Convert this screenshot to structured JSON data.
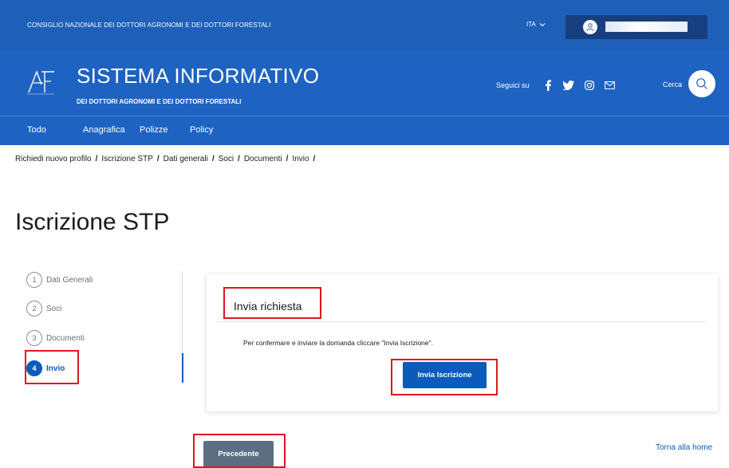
{
  "topbar": {
    "organization": "CONSIGLIO NAZIONALE DEI DOTTORI AGRONOMI E DEI DOTTORI FORESTALI",
    "language": "ITA"
  },
  "header": {
    "title": "SISTEMA INFORMATIVO",
    "subtitle": "DEI DOTTORI AGRONOMI E DEI DOTTORI FORESTALI",
    "follow_label": "Seguici su",
    "social_icons": [
      "facebook-icon",
      "twitter-icon",
      "instagram-icon",
      "mail-icon"
    ],
    "search_label": "Cerca"
  },
  "nav": {
    "items": [
      "Todo",
      "Anagrafica",
      "Polizze",
      "Policy"
    ]
  },
  "breadcrumb": {
    "items": [
      "Richiedi nuovo profilo",
      "Iscrizione STP",
      "Dati generali",
      "Soci",
      "Documenti",
      "Invio"
    ],
    "separator": "/"
  },
  "page": {
    "title": "Iscrizione STP"
  },
  "steps": [
    {
      "number": "1",
      "label": "Dati Generali"
    },
    {
      "number": "2",
      "label": "Soci"
    },
    {
      "number": "3",
      "label": "Documenti"
    },
    {
      "number": "4",
      "label": "Invio"
    }
  ],
  "card": {
    "title": "Invia richiesta",
    "message": "Per confermare e inviare la domanda cliccare \"Invia Iscrizione\".",
    "submit_label": "Invia Iscrizione"
  },
  "footer": {
    "previous_label": "Precedente",
    "home_link": "Torna alla home"
  },
  "colors": {
    "brand_blue": "#1e63c2",
    "dark_blue": "#173f80",
    "primary_button": "#0b5bbd",
    "secondary_button": "#5c6f82",
    "highlight_red": "#e0161e"
  }
}
